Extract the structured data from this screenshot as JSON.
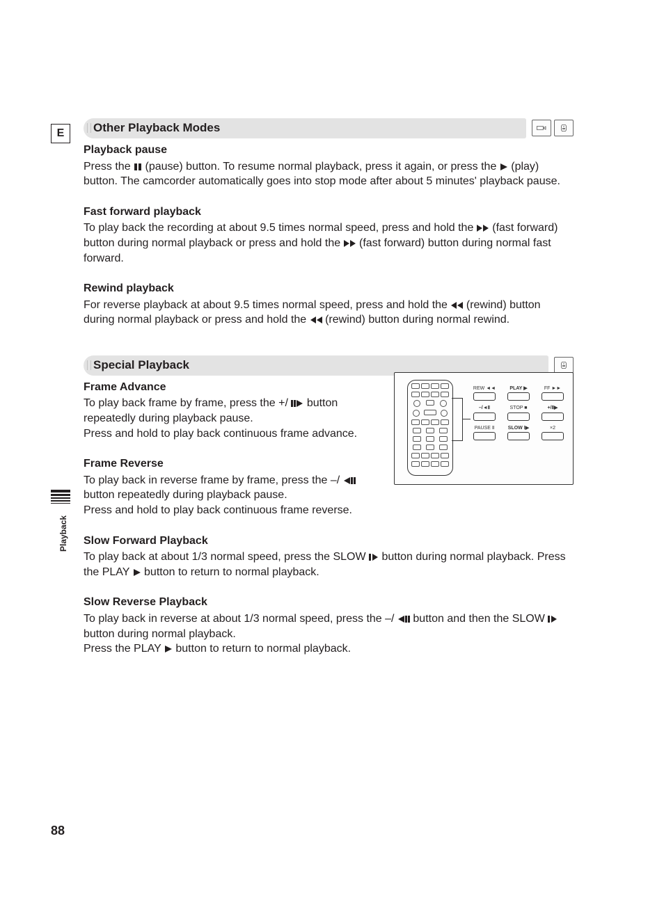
{
  "page_number": "88",
  "language_badge": "E",
  "side_label": "Playback",
  "section1": {
    "title": "Other Playback Modes",
    "sub1_title": "Playback pause",
    "sub1_text_a": "Press the ",
    "sub1_text_b": " (pause) button. To resume normal playback, press it again, or press the ",
    "sub1_text_c": " (play) button. The camcorder automatically goes into stop mode after about 5 minutes' playback pause.",
    "sub2_title": "Fast forward playback",
    "sub2_text_a": "To play back the recording at about 9.5 times normal speed, press and hold the ",
    "sub2_text_b": " (fast forward) button during normal playback or press and hold the ",
    "sub2_text_c": " (fast forward) button during normal fast forward.",
    "sub3_title": "Rewind playback",
    "sub3_text_a": "For reverse playback at about 9.5 times normal speed, press and hold the ",
    "sub3_text_b": " (rewind) button during normal playback or press and hold the ",
    "sub3_text_c": " (rewind) button during normal rewind."
  },
  "section2": {
    "title": "Special Playback",
    "sub1_title": "Frame Advance",
    "sub1_text_a": "To play back frame by frame, press the +/ ",
    "sub1_text_b": " button repeatedly during playback pause.",
    "sub1_text_c": "Press and hold to play back continuous frame advance.",
    "sub2_title": "Frame Reverse",
    "sub2_text_a": "To play back in reverse frame by frame, press the –/",
    "sub2_text_b": " button repeatedly during playback pause.",
    "sub2_text_c": "Press and hold to play back continuous frame reverse.",
    "sub3_title": "Slow Forward Playback",
    "sub3_text_a": "To play back at about 1/3 normal speed, press the SLOW ",
    "sub3_text_b": " button during normal playback. Press the PLAY ",
    "sub3_text_c": " button to return to normal playback.",
    "sub4_title": "Slow Reverse Playback",
    "sub4_text_a": "To play back in reverse at about 1/3 normal speed, press the –/",
    "sub4_text_b": " button and then the SLOW ",
    "sub4_text_c": " button during normal playback.",
    "sub4_text_d": "Press the PLAY ",
    "sub4_text_e": " button to return to normal playback."
  },
  "remote": {
    "r1c1": "REW",
    "r1c2": "PLAY",
    "r1c3": "FF",
    "r2c1": "–/",
    "r2c2": "STOP",
    "r2c3": "+/",
    "r3c1": "PAUSE",
    "r3c2": "SLOW",
    "r3c3": "×2"
  }
}
